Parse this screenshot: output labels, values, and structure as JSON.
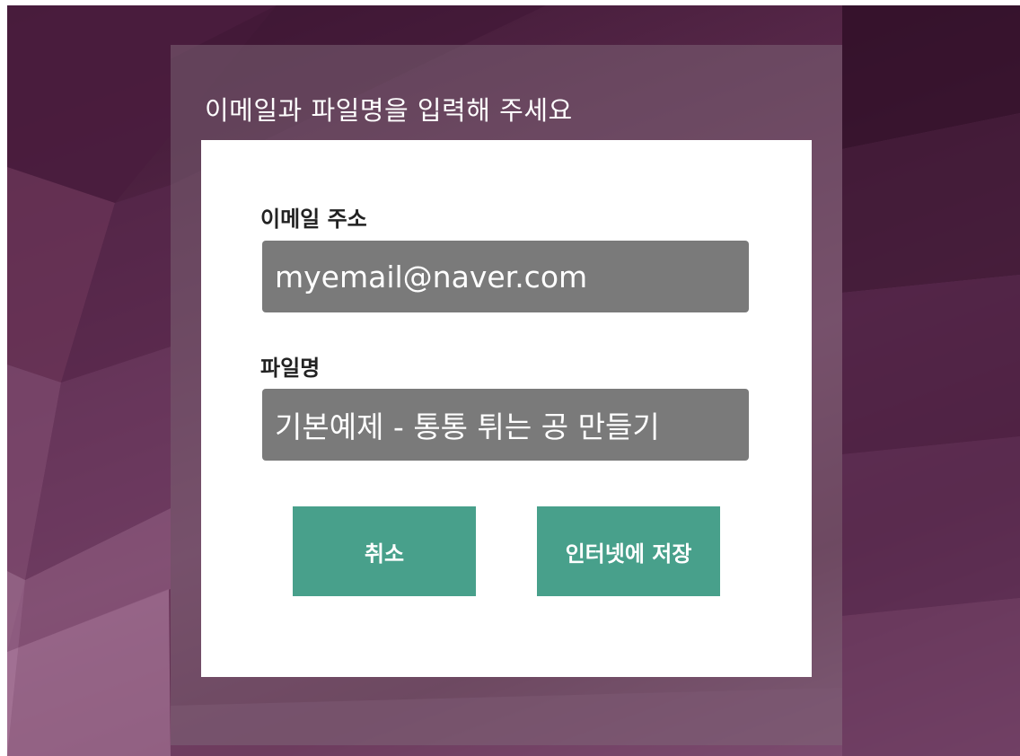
{
  "dialog": {
    "title": "이메일과 파일명을 입력해 주세요",
    "email": {
      "label": "이메일 주소",
      "value": "myemail@naver.com"
    },
    "filename": {
      "label": "파일명",
      "value": "기본예제 - 통통 튀는 공 만들기"
    },
    "buttons": {
      "cancel_label": "취소",
      "save_label": "인터넷에 저장"
    }
  },
  "colors": {
    "accent_button": "#48a08b",
    "input_background": "#7a7a7a",
    "panel_background": "#ffffff"
  }
}
